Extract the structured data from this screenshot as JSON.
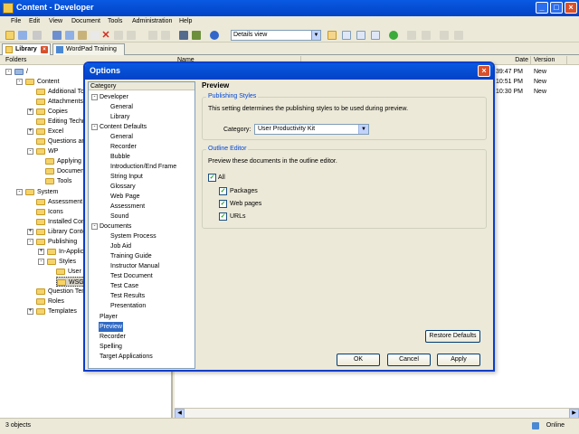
{
  "window": {
    "title": "Content - Developer"
  },
  "titlebar_buttons": {
    "minimize": "_",
    "maximize": "□",
    "close": "×"
  },
  "menu": [
    "File",
    "Edit",
    "View",
    "Document",
    "Tools",
    "Administration",
    "Help"
  ],
  "toolbar": {
    "view_select": "Details view"
  },
  "doc_tabs": [
    {
      "label": "Library",
      "active": true
    },
    {
      "label": "WordPad Training",
      "active": false
    }
  ],
  "folders": {
    "header": "Folders",
    "root": "/",
    "items": [
      "Content",
      "Additional Top",
      "Attachments",
      "Copies",
      "Editing Techni",
      "Excel",
      "Questions and",
      "WP",
      "Applying F",
      "Document",
      "Tools",
      "System",
      "Assessment T",
      "Icons",
      "Installed Cont",
      "Library Conten",
      "Publishing",
      "In-Applica",
      "Styles",
      "User P",
      "WSG",
      "Question Tem",
      "Roles",
      "Templates"
    ]
  },
  "list": {
    "columns": {
      "name": "Name",
      "date": "Date",
      "version": "Version"
    },
    "rows": [
      {
        "date": "39:47 PM",
        "version": "New"
      },
      {
        "date": "10:51 PM",
        "version": "New"
      },
      {
        "date": "10:30 PM",
        "version": "New"
      }
    ]
  },
  "status": {
    "objects": "3 objects",
    "mode": "Online"
  },
  "dialog": {
    "title": "Options",
    "close": "×",
    "category_header": "Category",
    "categories": [
      "Developer",
      "General",
      "Library",
      "Content Defaults",
      "General",
      "Recorder",
      "Bubble",
      "Introduction/End Frame",
      "String Input",
      "Glossary",
      "Web Page",
      "Assessment",
      "Sound",
      "Documents",
      "System Process",
      "Job Aid",
      "Training Guide",
      "Instructor Manual",
      "Test Document",
      "Test Case",
      "Test Results",
      "Presentation",
      "Player",
      "Preview",
      "Recorder",
      "Spelling",
      "Target Applications"
    ],
    "preview": {
      "heading": "Preview",
      "publishing_styles": {
        "legend": "Publishing Styles",
        "description": "This setting determines the publishing styles to be used during preview.",
        "category_label": "Category:",
        "category_value": "User Productivity Kit"
      },
      "outline_editor": {
        "legend": "Outline Editor",
        "description": "Preview these documents in the outline editor.",
        "all_label": "All",
        "options": [
          {
            "label": "Packages",
            "checked": true
          },
          {
            "label": "Web pages",
            "checked": true
          },
          {
            "label": "URLs",
            "checked": true
          }
        ]
      },
      "restore_defaults": "Restore Defaults"
    },
    "buttons": {
      "ok": "OK",
      "cancel": "Cancel",
      "apply": "Apply"
    }
  }
}
